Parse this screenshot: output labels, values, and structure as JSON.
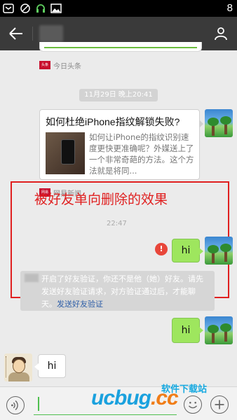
{
  "status_bar": {
    "time": "8"
  },
  "chat": {
    "sources": {
      "toutiao": "今日头条",
      "netease": "网易新闻",
      "toutiao_logo": "头条",
      "netease_logo": "网易"
    },
    "timestamp": "11月29日 晚上20:41",
    "article": {
      "title": "如何杜绝iPhone指纹解锁失败?",
      "description": "如何让iPhone的指纹识别速度更快更准确呢？外媒送上了一个非常奇葩的方法。这个方法就是将同..."
    },
    "annotation": "被好友单向删除的效果",
    "hidden_time": "22:47",
    "messages": [
      {
        "from": "me",
        "text": "hi",
        "status": "failed"
      },
      {
        "from": "me",
        "text": "hi"
      },
      {
        "from": "other",
        "text": "hi"
      }
    ],
    "system_message": {
      "text": "开启了好友验证，你还不是他（她）好友。请先发送好友验证请求，对方验证通过后，才能聊天。",
      "link": "发送好友验证"
    },
    "fail_glyph": "!"
  },
  "watermark": {
    "top": "软件下载站",
    "brand_prefix": "ucbug",
    "brand_suffix": ".cc"
  },
  "colors": {
    "accent_green": "#9ee65e",
    "annotation_red": "#e02020",
    "titlebar": "#3a3a3a"
  }
}
